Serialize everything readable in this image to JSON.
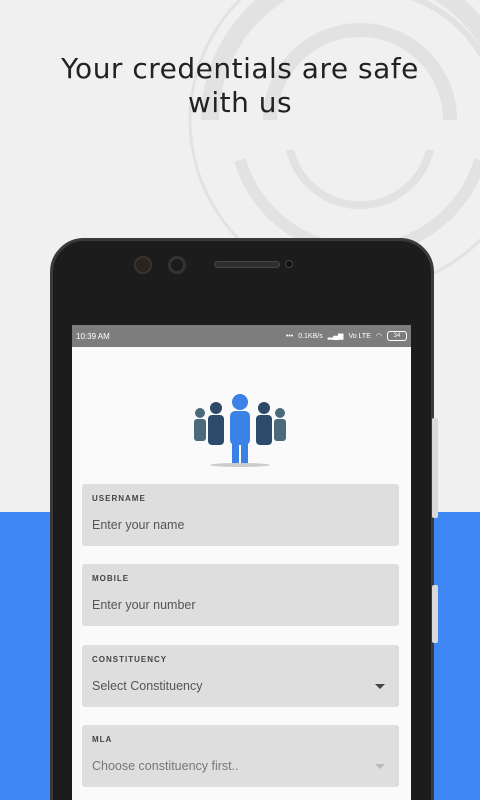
{
  "headline": {
    "line1": "Your credentials are safe",
    "line2": "with us"
  },
  "status_bar": {
    "time": "10:39 AM",
    "speed": "0.1KB/s",
    "network": "Vo LTE",
    "battery": "34"
  },
  "form": {
    "username": {
      "label": "USERNAME",
      "placeholder": "Enter your name"
    },
    "mobile": {
      "label": "MOBILE",
      "placeholder": "Enter your number"
    },
    "constituency": {
      "label": "CONSTITUENCY",
      "selected": "Select Constituency"
    },
    "mla": {
      "label": "MLA",
      "selected": "Choose constituency first.."
    }
  },
  "colors": {
    "accent_blue": "#3f87f5",
    "people_blue": "#3b82e6",
    "people_navy": "#2d4a6a",
    "people_slate": "#4a6a7a"
  },
  "icons": [
    "people-group-icon",
    "dropdown-caret-icon",
    "wifi-icon",
    "battery-icon",
    "signal-icon"
  ]
}
